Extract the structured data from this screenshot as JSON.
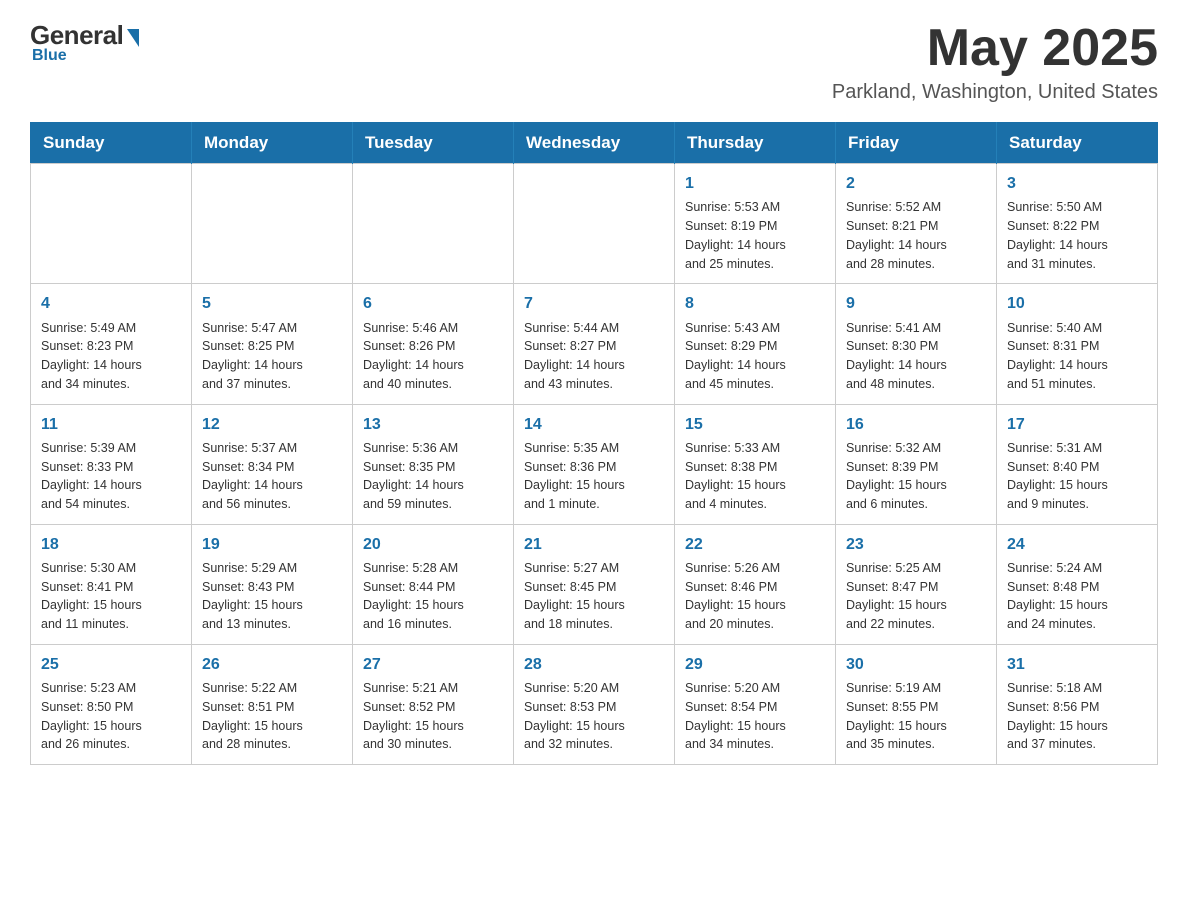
{
  "logo": {
    "general": "General",
    "blue": "Blue",
    "tagline": "Blue"
  },
  "title": {
    "month": "May 2025",
    "location": "Parkland, Washington, United States"
  },
  "weekdays": [
    "Sunday",
    "Monday",
    "Tuesday",
    "Wednesday",
    "Thursday",
    "Friday",
    "Saturday"
  ],
  "weeks": [
    [
      {
        "day": "",
        "info": ""
      },
      {
        "day": "",
        "info": ""
      },
      {
        "day": "",
        "info": ""
      },
      {
        "day": "",
        "info": ""
      },
      {
        "day": "1",
        "info": "Sunrise: 5:53 AM\nSunset: 8:19 PM\nDaylight: 14 hours\nand 25 minutes."
      },
      {
        "day": "2",
        "info": "Sunrise: 5:52 AM\nSunset: 8:21 PM\nDaylight: 14 hours\nand 28 minutes."
      },
      {
        "day": "3",
        "info": "Sunrise: 5:50 AM\nSunset: 8:22 PM\nDaylight: 14 hours\nand 31 minutes."
      }
    ],
    [
      {
        "day": "4",
        "info": "Sunrise: 5:49 AM\nSunset: 8:23 PM\nDaylight: 14 hours\nand 34 minutes."
      },
      {
        "day": "5",
        "info": "Sunrise: 5:47 AM\nSunset: 8:25 PM\nDaylight: 14 hours\nand 37 minutes."
      },
      {
        "day": "6",
        "info": "Sunrise: 5:46 AM\nSunset: 8:26 PM\nDaylight: 14 hours\nand 40 minutes."
      },
      {
        "day": "7",
        "info": "Sunrise: 5:44 AM\nSunset: 8:27 PM\nDaylight: 14 hours\nand 43 minutes."
      },
      {
        "day": "8",
        "info": "Sunrise: 5:43 AM\nSunset: 8:29 PM\nDaylight: 14 hours\nand 45 minutes."
      },
      {
        "day": "9",
        "info": "Sunrise: 5:41 AM\nSunset: 8:30 PM\nDaylight: 14 hours\nand 48 minutes."
      },
      {
        "day": "10",
        "info": "Sunrise: 5:40 AM\nSunset: 8:31 PM\nDaylight: 14 hours\nand 51 minutes."
      }
    ],
    [
      {
        "day": "11",
        "info": "Sunrise: 5:39 AM\nSunset: 8:33 PM\nDaylight: 14 hours\nand 54 minutes."
      },
      {
        "day": "12",
        "info": "Sunrise: 5:37 AM\nSunset: 8:34 PM\nDaylight: 14 hours\nand 56 minutes."
      },
      {
        "day": "13",
        "info": "Sunrise: 5:36 AM\nSunset: 8:35 PM\nDaylight: 14 hours\nand 59 minutes."
      },
      {
        "day": "14",
        "info": "Sunrise: 5:35 AM\nSunset: 8:36 PM\nDaylight: 15 hours\nand 1 minute."
      },
      {
        "day": "15",
        "info": "Sunrise: 5:33 AM\nSunset: 8:38 PM\nDaylight: 15 hours\nand 4 minutes."
      },
      {
        "day": "16",
        "info": "Sunrise: 5:32 AM\nSunset: 8:39 PM\nDaylight: 15 hours\nand 6 minutes."
      },
      {
        "day": "17",
        "info": "Sunrise: 5:31 AM\nSunset: 8:40 PM\nDaylight: 15 hours\nand 9 minutes."
      }
    ],
    [
      {
        "day": "18",
        "info": "Sunrise: 5:30 AM\nSunset: 8:41 PM\nDaylight: 15 hours\nand 11 minutes."
      },
      {
        "day": "19",
        "info": "Sunrise: 5:29 AM\nSunset: 8:43 PM\nDaylight: 15 hours\nand 13 minutes."
      },
      {
        "day": "20",
        "info": "Sunrise: 5:28 AM\nSunset: 8:44 PM\nDaylight: 15 hours\nand 16 minutes."
      },
      {
        "day": "21",
        "info": "Sunrise: 5:27 AM\nSunset: 8:45 PM\nDaylight: 15 hours\nand 18 minutes."
      },
      {
        "day": "22",
        "info": "Sunrise: 5:26 AM\nSunset: 8:46 PM\nDaylight: 15 hours\nand 20 minutes."
      },
      {
        "day": "23",
        "info": "Sunrise: 5:25 AM\nSunset: 8:47 PM\nDaylight: 15 hours\nand 22 minutes."
      },
      {
        "day": "24",
        "info": "Sunrise: 5:24 AM\nSunset: 8:48 PM\nDaylight: 15 hours\nand 24 minutes."
      }
    ],
    [
      {
        "day": "25",
        "info": "Sunrise: 5:23 AM\nSunset: 8:50 PM\nDaylight: 15 hours\nand 26 minutes."
      },
      {
        "day": "26",
        "info": "Sunrise: 5:22 AM\nSunset: 8:51 PM\nDaylight: 15 hours\nand 28 minutes."
      },
      {
        "day": "27",
        "info": "Sunrise: 5:21 AM\nSunset: 8:52 PM\nDaylight: 15 hours\nand 30 minutes."
      },
      {
        "day": "28",
        "info": "Sunrise: 5:20 AM\nSunset: 8:53 PM\nDaylight: 15 hours\nand 32 minutes."
      },
      {
        "day": "29",
        "info": "Sunrise: 5:20 AM\nSunset: 8:54 PM\nDaylight: 15 hours\nand 34 minutes."
      },
      {
        "day": "30",
        "info": "Sunrise: 5:19 AM\nSunset: 8:55 PM\nDaylight: 15 hours\nand 35 minutes."
      },
      {
        "day": "31",
        "info": "Sunrise: 5:18 AM\nSunset: 8:56 PM\nDaylight: 15 hours\nand 37 minutes."
      }
    ]
  ]
}
